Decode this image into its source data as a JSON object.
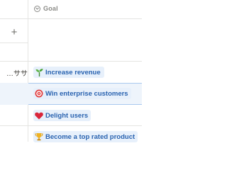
{
  "header": {
    "goal_column_label": "Goal",
    "goal_column_icon": "chevron-down-circle-icon",
    "add_column_icon": "plus-icon"
  },
  "rows": [
    {
      "left_text": "ササ…",
      "goal": {
        "icon": "seedling-icon",
        "label": "Increase revenue"
      }
    },
    {
      "left_text": "",
      "goal": {
        "icon": "target-icon",
        "label": "Win enterprise customers"
      },
      "selected": true
    },
    {
      "left_text": "",
      "goal": {
        "icon": "heart-icon",
        "label": "Delight users"
      }
    },
    {
      "left_text": "",
      "goal": {
        "icon": "trophy-icon",
        "label": "Become a top rated product"
      }
    }
  ],
  "colors": {
    "goal_text": "#2a63b0",
    "goal_chip_bg": "#e7f0fb",
    "grid_line": "#e4e4e2",
    "selected_bg": "#eef4fb"
  }
}
